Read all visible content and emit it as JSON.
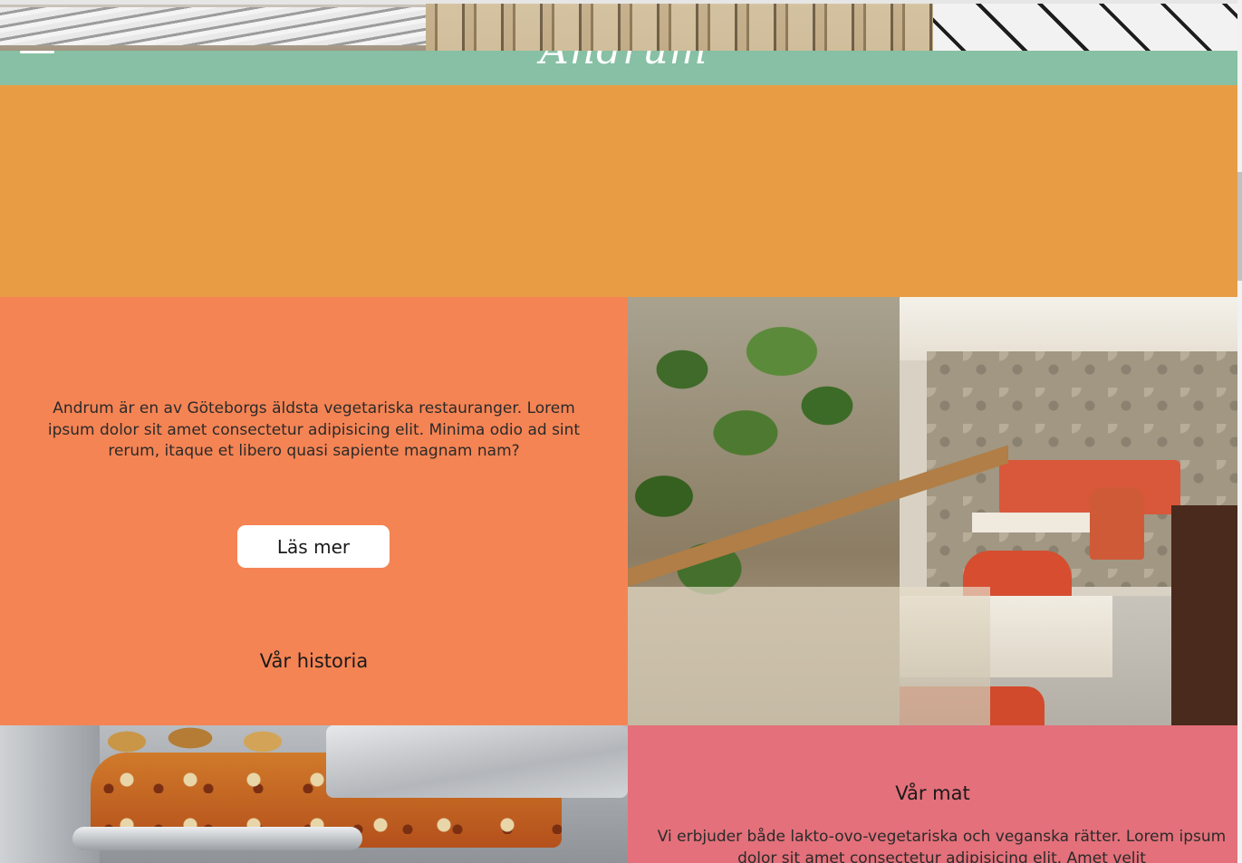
{
  "header": {
    "logo_text": "Andrum",
    "menu_icon": "hamburger-menu-icon",
    "bar_color": "#87c0a4"
  },
  "sections": {
    "history": {
      "title": "Vår historia",
      "text": "Andrum är en av Göteborgs äldsta vegetariska restauranger. Lorem ipsum dolor sit amet consectetur adipisicing elit. Minima odio ad sint rerum, itaque et libero quasi sapiente magnam nam?",
      "button_label": "Läs mer",
      "bg_color": "#f58454"
    },
    "food": {
      "title": "Vår mat",
      "text": "Vi erbjuder både lakto-ovo-vegetariska och veganska rätter. Lorem ipsum dolor sit amet consectetur adipisicing elit. Amet velit",
      "bg_color": "#e3707a"
    }
  },
  "colors": {
    "orange_block": "#e89d45"
  }
}
